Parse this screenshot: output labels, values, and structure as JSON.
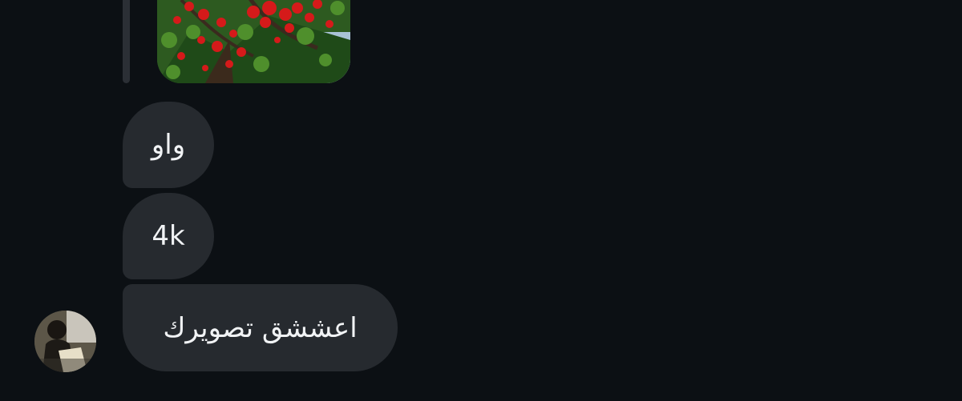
{
  "messages": [
    {
      "text": "واو"
    },
    {
      "text": "4k"
    },
    {
      "text": "اعششق تصويرك"
    }
  ],
  "colors": {
    "background": "#0c1014",
    "bubble": "#262a2f",
    "text": "#f1f3f5",
    "reply_bar": "#2b2f35"
  },
  "icons": {
    "avatar": "user-avatar"
  }
}
